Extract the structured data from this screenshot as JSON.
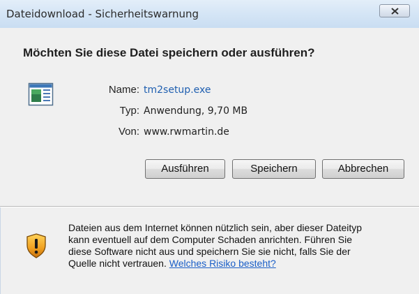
{
  "window": {
    "title": "Dateidownload - Sicherheitswarnung",
    "close_icon": "close-x-icon"
  },
  "dialog": {
    "question": "Möchten Sie diese Datei speichern oder ausführen?",
    "file_icon": "application-window-icon",
    "fields": {
      "name_label": "Name:",
      "name_value": "tm2setup.exe",
      "type_label": "Typ:",
      "type_value": "Anwendung, 9,70 MB",
      "from_label": "Von:",
      "from_value": "www.rwmartin.de"
    },
    "buttons": {
      "run": "Ausführen",
      "save": "Speichern",
      "cancel": "Abbrechen"
    }
  },
  "warning": {
    "icon": "security-shield-icon",
    "lines": [
      "Dateien aus dem Internet können nützlich sein, aber dieser Dateityp",
      "kann eventuell auf dem Computer Schaden anrichten. Führen Sie",
      "diese Software nicht aus und speichern Sie sie nicht, falls Sie der",
      "Quelle nicht vertrauen."
    ],
    "link": "Welches Risiko besteht?"
  },
  "colors": {
    "link": "#1a5ec7",
    "filename": "#1f5fb0",
    "shield_orange": "#e89a1a"
  }
}
